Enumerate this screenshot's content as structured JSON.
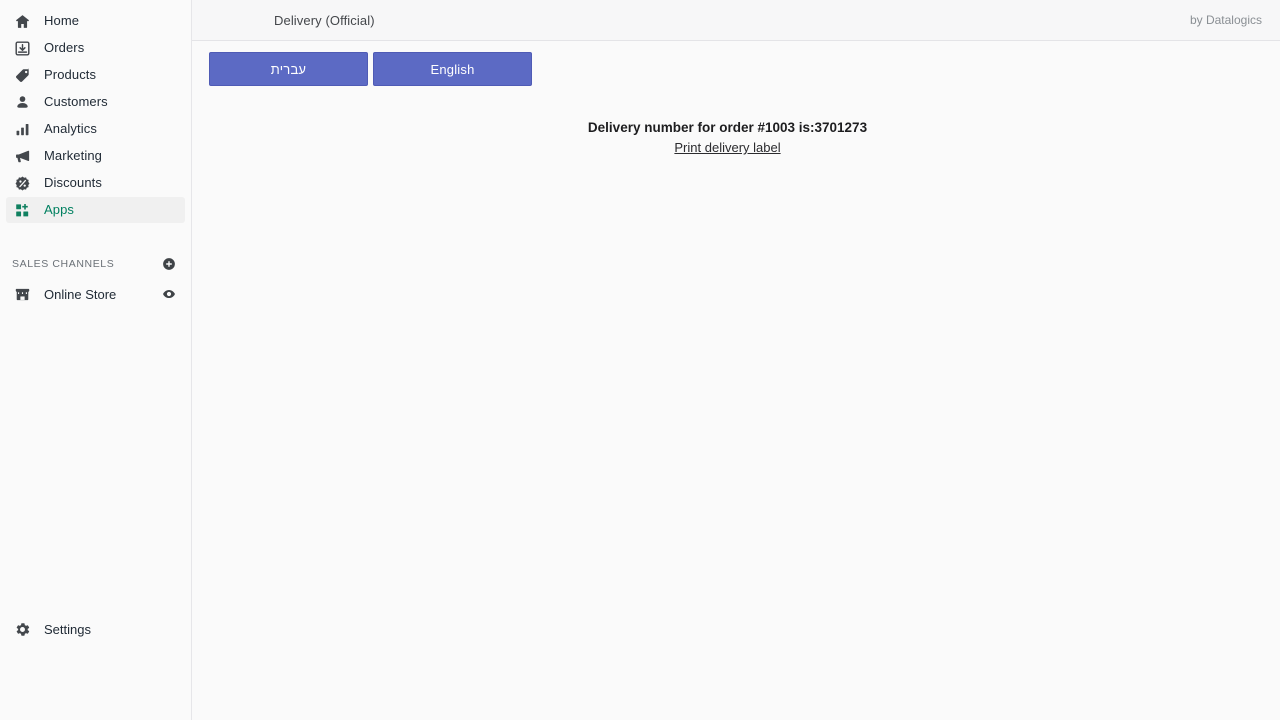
{
  "sidebar": {
    "nav_items": [
      {
        "label": "Home",
        "icon": "home-icon",
        "active": false
      },
      {
        "label": "Orders",
        "icon": "orders-icon",
        "active": false
      },
      {
        "label": "Products",
        "icon": "tag-icon",
        "active": false
      },
      {
        "label": "Customers",
        "icon": "person-icon",
        "active": false
      },
      {
        "label": "Analytics",
        "icon": "bar-chart-icon",
        "active": false
      },
      {
        "label": "Marketing",
        "icon": "megaphone-icon",
        "active": false
      },
      {
        "label": "Discounts",
        "icon": "discount-icon",
        "active": false
      },
      {
        "label": "Apps",
        "icon": "apps-icon",
        "active": true
      }
    ],
    "sales_channels": {
      "section_title": "SALES CHANNELS",
      "add_icon": "plus-circle-icon",
      "items": [
        {
          "label": "Online Store",
          "icon": "store-icon",
          "action_icon": "eye-icon"
        }
      ]
    },
    "settings": {
      "label": "Settings",
      "icon": "gear-icon"
    },
    "active_color": "#008060",
    "active_bg": "#f0f0f0"
  },
  "appbar": {
    "title": "Delivery (Official)",
    "by_line": "by Datalogics"
  },
  "content": {
    "language_buttons": [
      {
        "label": "עברית",
        "name": "hebrew-language-button"
      },
      {
        "label": "English",
        "name": "english-language-button"
      }
    ],
    "button_color": "#5c6ac4",
    "delivery_message": "Delivery number for order #1003 is:3701273",
    "print_link": "Print delivery label"
  }
}
